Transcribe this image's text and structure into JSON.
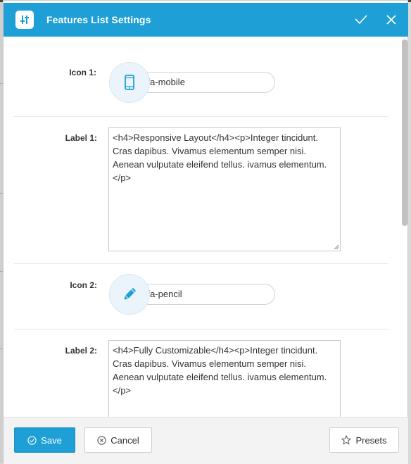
{
  "header": {
    "title": "Features List Settings",
    "confirm_icon": "check-icon",
    "close_icon": "close-icon",
    "app_icon": "settings-sliders-icon"
  },
  "fields": [
    {
      "label": "Icon 1:",
      "icon_name": "mobile-icon",
      "value": "fa fa-mobile"
    },
    {
      "label": "Label 1:",
      "value": "<h4>Responsive Layout</h4><p>Integer tincidunt. Cras dapibus. Vivamus elementum semper nisi. Aenean vulputate eleifend tellus. ivamus elementum.</p>"
    },
    {
      "label": "Icon 2:",
      "icon_name": "pencil-icon",
      "value": "fa fa-pencil"
    },
    {
      "label": "Label 2:",
      "value": "<h4>Fully Customizable</h4><p>Integer tincidunt. Cras dapibus. Vivamus elementum semper nisi. Aenean vulputate eleifend tellus. ivamus elementum.</p>"
    }
  ],
  "footer": {
    "save_label": "Save",
    "cancel_label": "Cancel",
    "presets_label": "Presets"
  },
  "colors": {
    "accent": "#1e9fd5",
    "icon_bg": "#eaf4fa",
    "footer_bg": "#f3f3f3"
  }
}
